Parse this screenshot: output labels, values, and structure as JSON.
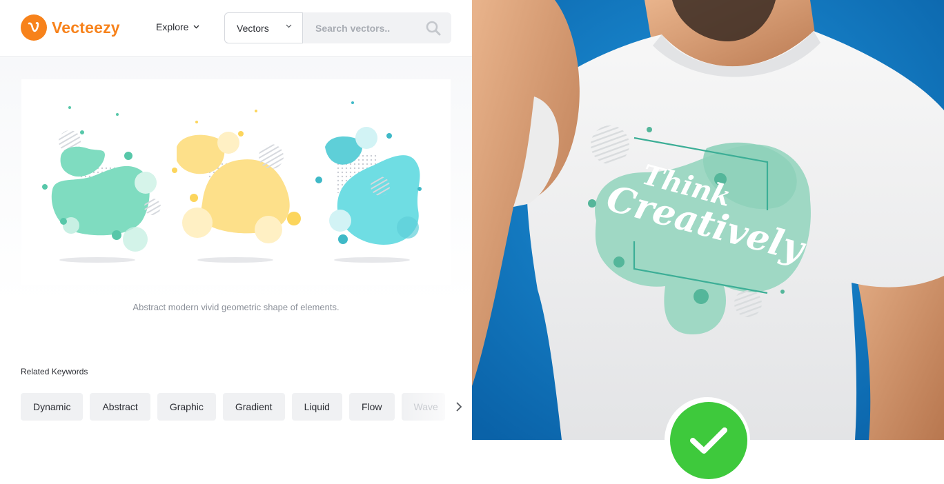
{
  "brand": {
    "name": "Vecteezy",
    "color": "#f7821b"
  },
  "nav": {
    "explore_label": "Explore"
  },
  "search": {
    "type_label": "Vectors",
    "placeholder": "Search vectors.."
  },
  "asset": {
    "caption": "Abstract modern vivid geometric shape of elements.",
    "colors": [
      "#7fdcc0",
      "#fde08a",
      "#6fdde3"
    ]
  },
  "related": {
    "title": "Related Keywords",
    "keywords": [
      "Dynamic",
      "Abstract",
      "Graphic",
      "Gradient",
      "Liquid",
      "Flow",
      "Wave"
    ]
  },
  "mockup": {
    "shirt_text_line1": "Think",
    "shirt_text_line2": "Creatively",
    "background_color": "#0f7dc6",
    "badge_color": "#3ec93c"
  }
}
